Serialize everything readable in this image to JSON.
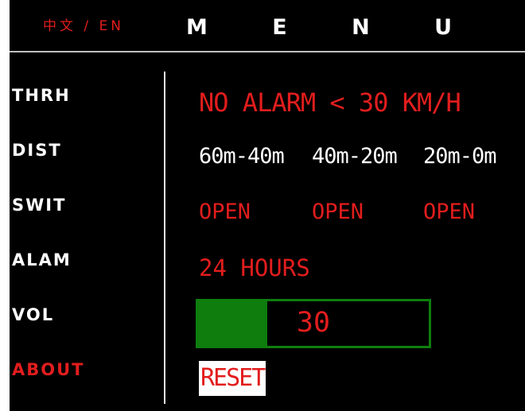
{
  "header": {
    "language_toggle": "中文 / EN",
    "title": "M E N U"
  },
  "sidebar": {
    "items": [
      {
        "label": "THRH"
      },
      {
        "label": "DIST"
      },
      {
        "label": "SWIT"
      },
      {
        "label": "ALAM"
      },
      {
        "label": "VOL"
      },
      {
        "label": "ABOUT"
      }
    ]
  },
  "main": {
    "threshold": "NO ALARM < 30 KM/H",
    "distances": [
      "60m-40m",
      "40m-20m",
      "20m-0m"
    ],
    "switches": [
      "OPEN",
      "OPEN",
      "OPEN"
    ],
    "alarm": "24 HOURS",
    "volume": {
      "value": "30",
      "level": 0.3
    },
    "reset_label": "RESET"
  },
  "colors": {
    "accent_red": "#e21d1d",
    "volume_green": "#0e7d0e",
    "background": "#000000",
    "text": "#ffffff"
  }
}
